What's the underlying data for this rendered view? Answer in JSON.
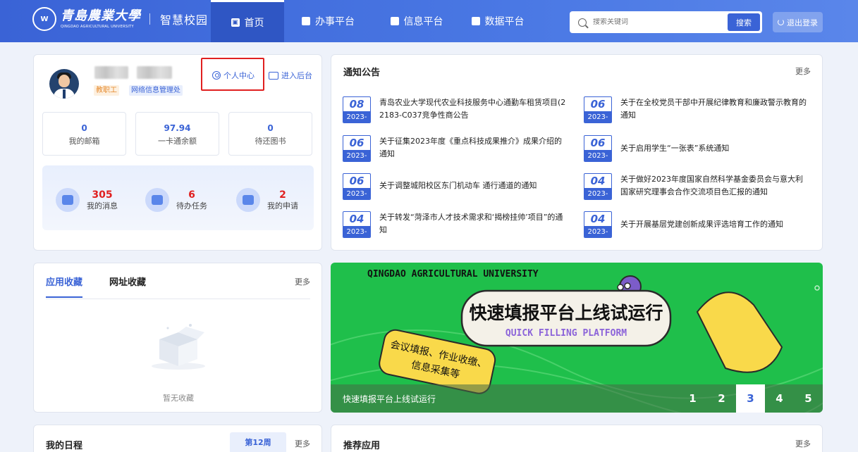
{
  "header": {
    "logo_seal": "W",
    "logo_cn": "青島農業大學",
    "logo_en": "QINGDAO AGRICULTURAL UNIVERSITY",
    "logo_sub": "智慧校园",
    "nav": [
      {
        "label": "首页",
        "icon": "home-icon",
        "active": true
      },
      {
        "label": "办事平台",
        "icon": "edit-icon",
        "active": false
      },
      {
        "label": "信息平台",
        "icon": "document-icon",
        "active": false
      },
      {
        "label": "数据平台",
        "icon": "chart-icon",
        "active": false
      }
    ],
    "search_placeholder": "搜索关键词",
    "search_button": "搜索",
    "logout": "退出登录"
  },
  "profile": {
    "tag_role": "教职工",
    "tag_dept": "网络信息管理处",
    "link_personal": "个人中心",
    "link_admin": "进入后台",
    "stats": [
      {
        "value": "0",
        "label": "我的邮箱"
      },
      {
        "value": "97.94",
        "label": "一卡通余额"
      },
      {
        "value": "0",
        "label": "待还图书"
      }
    ],
    "messages": [
      {
        "value": "305",
        "label": "我的消息"
      },
      {
        "value": "6",
        "label": "待办任务"
      },
      {
        "value": "2",
        "label": "我的申请"
      }
    ]
  },
  "notice": {
    "title": "通知公告",
    "more": "更多",
    "items": [
      {
        "day": "08",
        "ym": "2023-04",
        "text": "青岛农业大学现代农业科技服务中心通勤车租赁项目(2 2183-C037竞争性商公告"
      },
      {
        "day": "06",
        "ym": "2023-04",
        "text": "关于在全校党员干部中开展纪律教育和廉政警示教育的通知"
      },
      {
        "day": "06",
        "ym": "2023-04",
        "text": "关于征集2023年度《重点科技成果推介》成果介绍的通知"
      },
      {
        "day": "06",
        "ym": "2023-04",
        "text": "关于启用学生“一张表”系统通知"
      },
      {
        "day": "06",
        "ym": "2023-04",
        "text": "关于调整城阳校区东门机动车 通行通道的通知"
      },
      {
        "day": "04",
        "ym": "2023-04",
        "text": "关于做好2023年度国家自然科学基金委员会与意大利国家研究理事会合作交流项目色汇报的通知"
      },
      {
        "day": "04",
        "ym": "2023-04",
        "text": "关于转发“菏泽市人才技术需求和‘揭榜挂帅’项目”的通知"
      },
      {
        "day": "04",
        "ym": "2023-04",
        "text": "关于开展基层党建创新成果评选培育工作的通知"
      }
    ]
  },
  "favorites": {
    "tabs": [
      "应用收藏",
      "网址收藏"
    ],
    "more": "更多",
    "empty": "暂无收藏"
  },
  "banner": {
    "univ": "QINGDAO AGRICULTURAL UNIVERSITY",
    "headline": "快速填报平台上线试运行",
    "headline_en": "QUICK FILLING PLATFORM",
    "bubble_line1": "会议填报、作业收缴、",
    "bubble_line2": "信息采集等",
    "caption": "快速填报平台上线试运行",
    "pages": [
      "1",
      "2",
      "3",
      "4",
      "5"
    ],
    "active_page": 3
  },
  "schedule": {
    "title": "我的日程",
    "week": "第12周",
    "more": "更多"
  },
  "recommend": {
    "title": "推荐应用",
    "more": "更多"
  }
}
